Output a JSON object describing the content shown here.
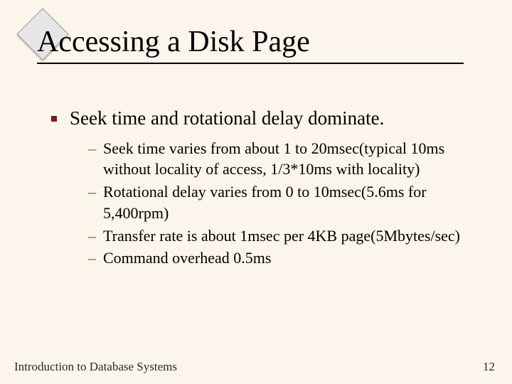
{
  "title": "Accessing a Disk Page",
  "main_point": "Seek time and rotational delay dominate.",
  "sub_points": [
    "Seek time varies from about 1 to 20msec(typical 10ms without locality of access, 1/3*10ms with locality)",
    "Rotational delay varies from 0 to 10msec(5.6ms for 5,400rpm)",
    "Transfer rate is about 1msec per 4KB page(5Mbytes/sec)",
    "Command overhead 0.5ms"
  ],
  "footer": {
    "left": "Introduction to Database Systems",
    "right": "12"
  }
}
